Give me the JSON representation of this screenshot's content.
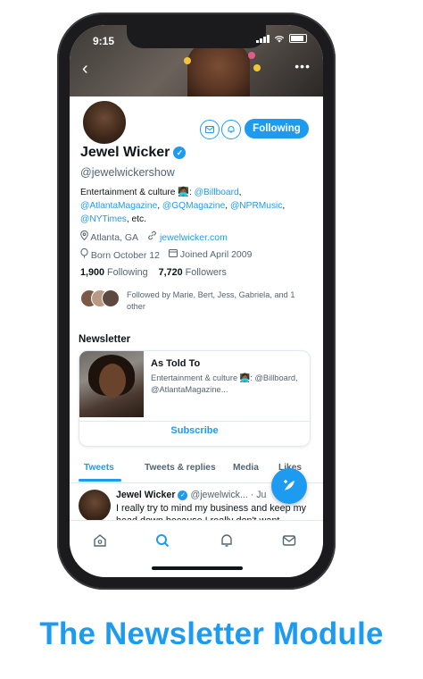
{
  "colors": {
    "accent": "#1d9bf0",
    "text": "#0f1419",
    "muted": "#536471"
  },
  "status_bar": {
    "time": "9:15"
  },
  "profile": {
    "name": "Jewel Wicker",
    "handle": "@jewelwickershow",
    "follow_button": "Following",
    "bio_line1_text": "Entertainment & culture ",
    "bio_line1_emoji": "👩🏾‍💻",
    "bio_line1_sep": ": ",
    "mention_billboard": "@Billboard",
    "mention_atlanta": "@AtlantaMagazine",
    "mention_gq": "@GQMagazine",
    "mention_npr": "@NPRMusic",
    "mention_nyt": "@NYTimes",
    "bio_etc": ", etc.",
    "location": "Atlanta, GA",
    "website": "jewelwicker.com",
    "born": "Born October 12",
    "joined": "Joined April 2009",
    "following_count": "1,900",
    "following_label": "Following",
    "followers_count": "7,720",
    "followers_label": "Followers",
    "followed_by": "Followed by Marie, Bert, Jess, Gabriela, and 1 other"
  },
  "newsletter": {
    "section_title": "Newsletter",
    "title": "As Told To",
    "description": "Entertainment & culture 👩🏾‍💻: @Billboard, @AtlantaMagazine...",
    "subscribe": "Subscribe"
  },
  "tabs": [
    "Tweets",
    "Tweets & replies",
    "Media",
    "Likes"
  ],
  "tweet": {
    "author": "Jewel Wicker",
    "handle": "@jewelwick...",
    "date": "· Ju",
    "text": "I really try to mind my business and keep my head down because I really don't want"
  },
  "bottom_nav": [
    "home-icon",
    "search-icon",
    "bell-icon",
    "mail-icon"
  ],
  "caption": "The Newsletter Module"
}
